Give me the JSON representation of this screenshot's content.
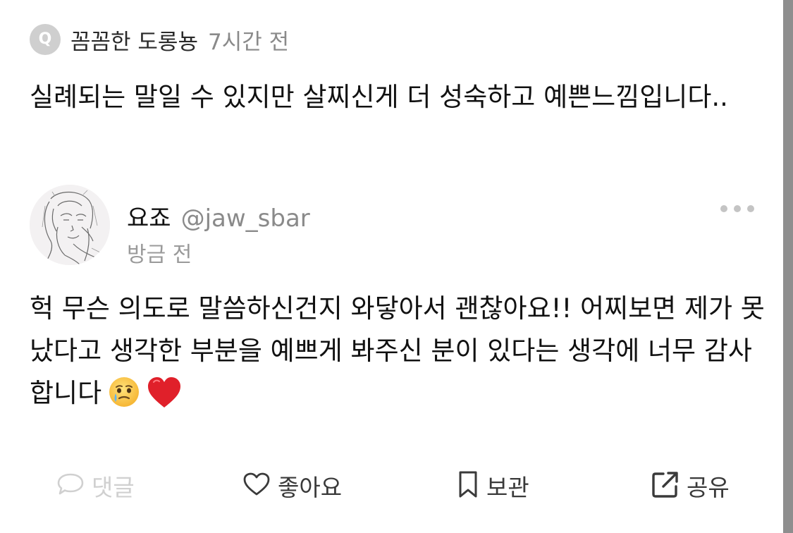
{
  "question": {
    "badge_letter": "Q",
    "author": "꼼꼼한 도롱뇽",
    "time": "7시간 전",
    "text": "실례되는 말일 수 있지만 살찌신게 더 성숙하고 예쁜느낌입니다.."
  },
  "answer": {
    "name": "요죠",
    "handle": "@jaw_sbar",
    "time": "방금 전",
    "text": "헉 무슨 의도로 말씀하신건지 와닿아서 괜찮아요!! 어찌보면 제가 못났다고 생각한 부분을 예쁘게 봐주신 분이 있다는 생각에 너무 감사합니다",
    "emojis": [
      "face-holding-back-tears",
      "red-heart"
    ]
  },
  "actions": {
    "comment_label": "댓글",
    "like_label": "좋아요",
    "save_label": "보관",
    "share_label": "공유"
  },
  "colors": {
    "text": "#111111",
    "muted": "#8a8a8a",
    "disabled": "#d0d0d0",
    "heart": "#e0202a"
  }
}
